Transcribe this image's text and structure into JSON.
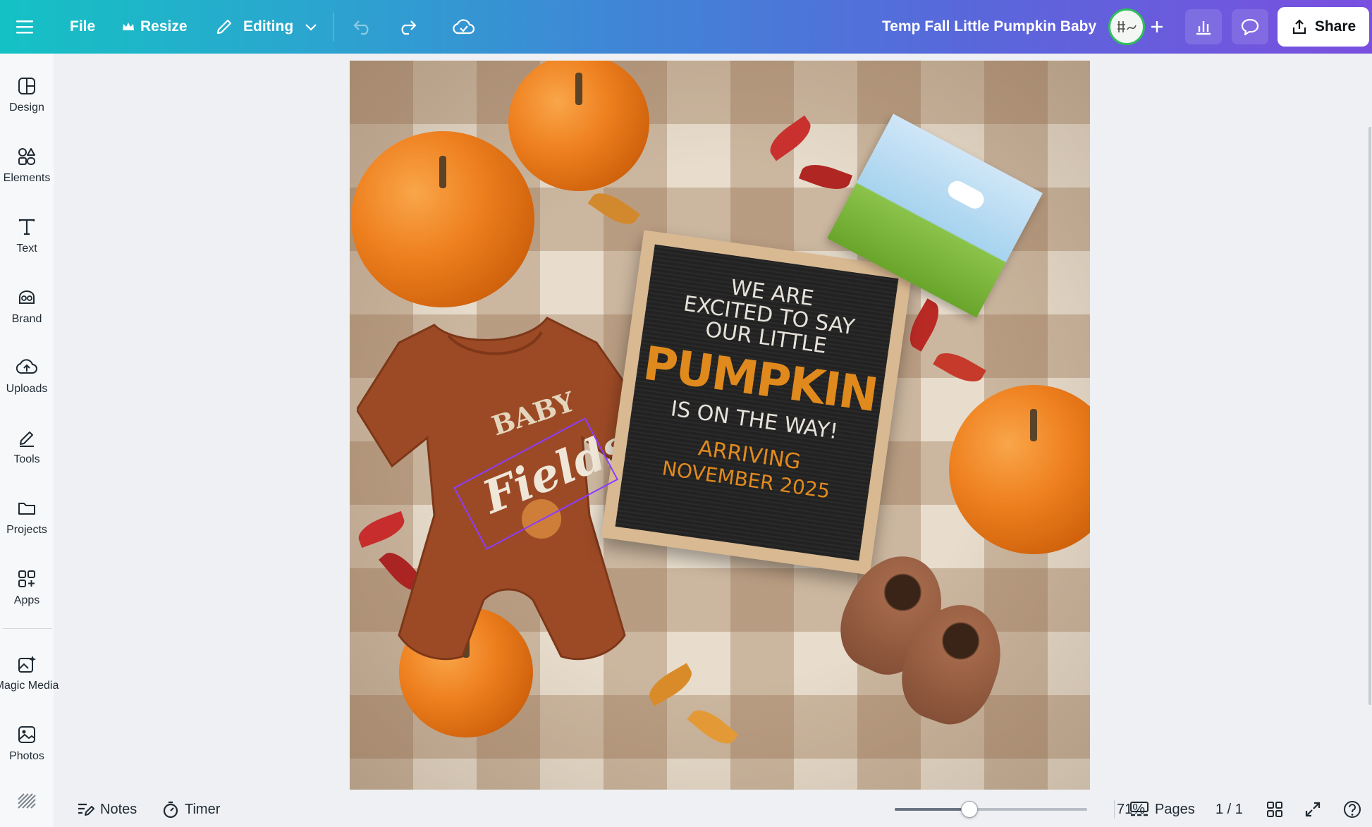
{
  "topbar": {
    "file_label": "File",
    "resize_label": "Resize",
    "mode_label": "Editing",
    "design_title": "Temp Fall Little Pumpkin Baby",
    "share_label": "Share"
  },
  "sidebar": {
    "items": [
      {
        "label": "Design",
        "icon": "design-icon"
      },
      {
        "label": "Elements",
        "icon": "elements-icon"
      },
      {
        "label": "Text",
        "icon": "text-icon"
      },
      {
        "label": "Brand",
        "icon": "brand-icon"
      },
      {
        "label": "Uploads",
        "icon": "uploads-icon"
      },
      {
        "label": "Tools",
        "icon": "tools-icon"
      },
      {
        "label": "Projects",
        "icon": "projects-icon"
      },
      {
        "label": "Apps",
        "icon": "apps-icon"
      },
      {
        "label": "Magic Media",
        "icon": "magic-media-icon"
      },
      {
        "label": "Photos",
        "icon": "photos-icon"
      }
    ]
  },
  "canvas": {
    "board_lines": [
      "WE ARE",
      "EXCITED TO SAY",
      "OUR LITTLE",
      "PUMPKIN",
      "IS ON THE WAY!",
      "ARRIVING",
      "NOVEMBER 2025"
    ],
    "onesie_line1": "BABY",
    "onesie_line2": "Fields"
  },
  "bottombar": {
    "notes_label": "Notes",
    "timer_label": "Timer",
    "zoom_value": "71%",
    "zoom_fraction": 0.39,
    "pages_label": "Pages",
    "page_count": "1 / 1"
  },
  "colors": {
    "accent": "#8b3dff",
    "pumpkin": "#ee7f1e",
    "board": "#222222",
    "board_text_light": "#e6e2da",
    "board_text_orange": "#e08a1e"
  }
}
